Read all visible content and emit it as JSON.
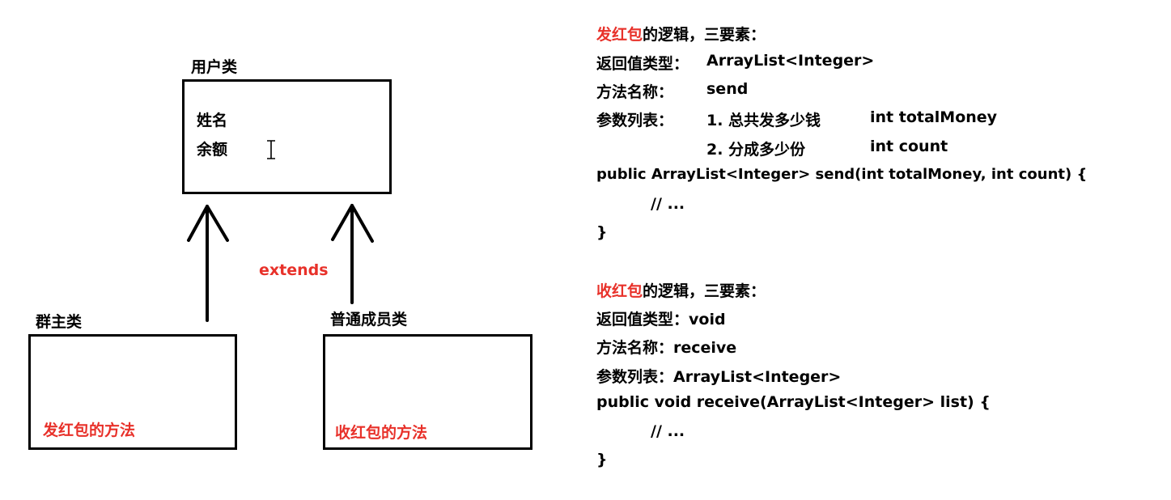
{
  "diagram": {
    "parent_title": "用户类",
    "parent_fields": [
      "姓名",
      "余额"
    ],
    "extends_label": "extends",
    "owner_title": "群主类",
    "owner_method": "发红包的方法",
    "member_title": "普通成员类",
    "member_method": "收红包的方法"
  },
  "send": {
    "title_red": "发红包",
    "title_rest": "的逻辑，三要素：",
    "return_label": "返回值类型：",
    "return_value": "ArrayList<Integer>",
    "name_label": "方法名称：",
    "name_value": "send",
    "params_label": "参数列表：",
    "param1_desc": "1. 总共发多少钱",
    "param1_code": "int totalMoney",
    "param2_desc": "2. 分成多少份",
    "param2_code": "int count",
    "signature": "public ArrayList<Integer> send(int totalMoney, int count) {",
    "body": "// ...",
    "close": "}"
  },
  "receive": {
    "title_red": "收红包",
    "title_rest": "的逻辑，三要素：",
    "return_line": "返回值类型：void",
    "name_line": "方法名称：receive",
    "params_line": "参数列表：ArrayList<Integer>",
    "signature": "public void receive(ArrayList<Integer> list) {",
    "body": "// ...",
    "close": "}"
  },
  "colors": {
    "accent": "#e8312a"
  },
  "icons": {
    "cursor": "text-cursor-icon"
  }
}
